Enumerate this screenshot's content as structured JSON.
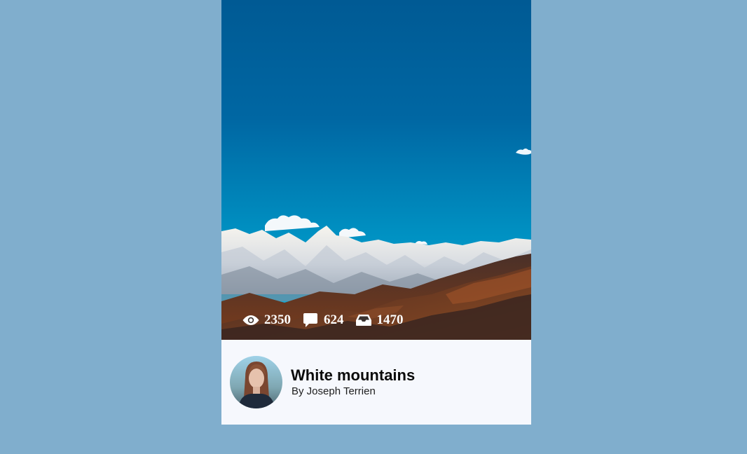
{
  "card": {
    "title": "White mountains",
    "author": "By Joseph Terrien",
    "stats": {
      "views": "2350",
      "comments": "624",
      "saves": "1470"
    },
    "icons": {
      "views": "eye-icon",
      "comments": "comment-icon",
      "saves": "inbox-icon"
    }
  },
  "colors": {
    "page_background": "#80aecd",
    "footer_background": "#f6f8fd",
    "sky_top": "#005e98",
    "sky_bottom": "#00a7d2"
  }
}
